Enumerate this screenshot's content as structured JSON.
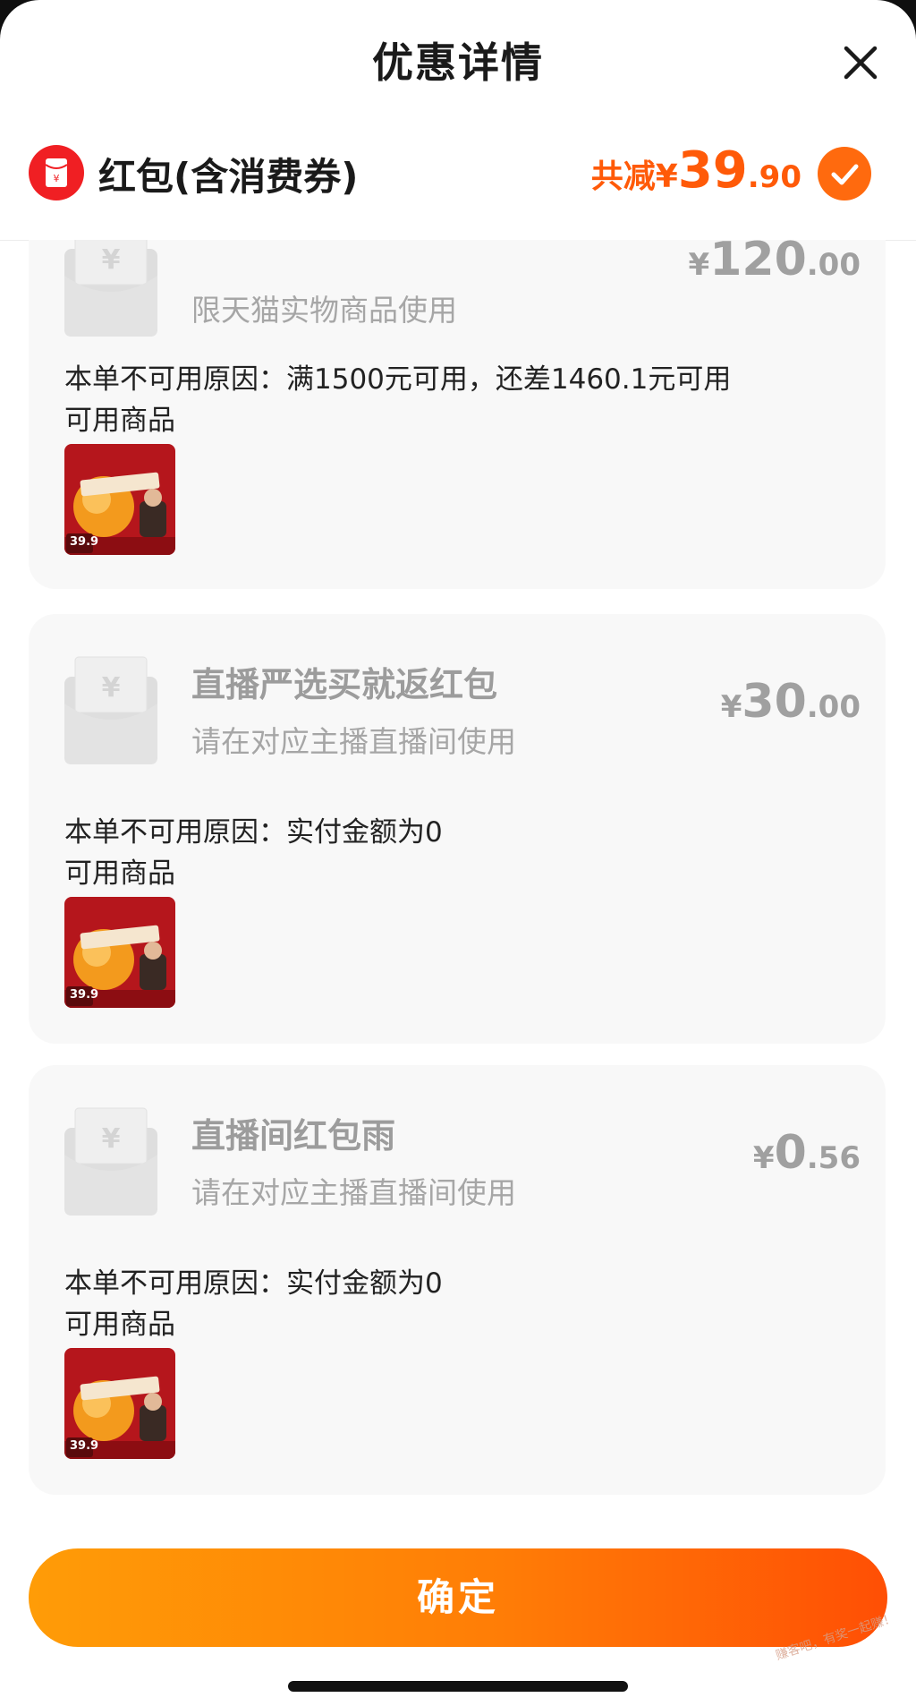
{
  "header": {
    "title": "优惠详情",
    "close_icon": "close-icon"
  },
  "summary": {
    "label": "红包(含消费券)",
    "total_prefix": "共减¥",
    "total_int": "39",
    "total_dec": ".90",
    "icon": "red-packet-icon",
    "check_icon": "check-icon",
    "accent": "#ff5a08"
  },
  "coupons": [
    {
      "name": "",
      "desc": "限天猫实物商品使用",
      "amount_currency": "¥",
      "amount_int": "120",
      "amount_dec": ".00",
      "reason": "本单不可用原因：满1500元可用，还差1460.1元可用",
      "goods_label": "可用商品",
      "thumb_price": "39.9"
    },
    {
      "name": "直播严选买就返红包",
      "desc": "请在对应主播直播间使用",
      "amount_currency": "¥",
      "amount_int": "30",
      "amount_dec": ".00",
      "reason": "本单不可用原因：实付金额为0",
      "goods_label": "可用商品",
      "thumb_price": "39.9"
    },
    {
      "name": "直播间红包雨",
      "desc": "请在对应主播直播间使用",
      "amount_currency": "¥",
      "amount_int": "0",
      "amount_dec": ".56",
      "reason": "本单不可用原因：实付金额为0",
      "goods_label": "可用商品",
      "thumb_price": "39.9"
    }
  ],
  "footer": {
    "confirm_label": "确定"
  },
  "watermark": "赚客吧，有奖一起赚！"
}
